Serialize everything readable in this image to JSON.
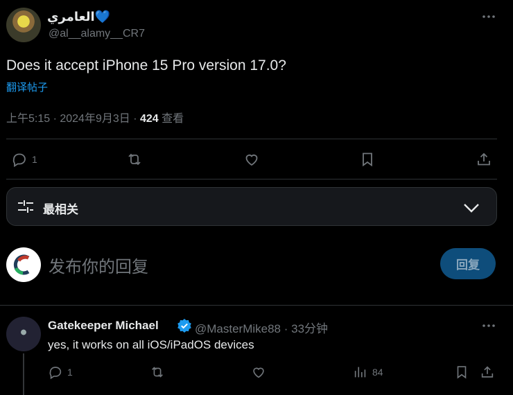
{
  "tweet": {
    "display_name": "العامري💙  ",
    "handle": "@al__alamy__CR7",
    "text": "Does it accept iPhone 15 Pro version 17.0?",
    "translate_label": "翻译帖子",
    "time": "上午5:15 · 2024年9月3日 · ",
    "views_count": "424",
    "views_label": " 查看",
    "replies_count": "1"
  },
  "sort": {
    "label": "最相关"
  },
  "composer": {
    "placeholder": "发布你的回复",
    "button_label": "回复"
  },
  "reply": {
    "display_name": "Gatekeeper Michael",
    "handle_time": "@MasterMike88 · 33分钟",
    "text": "yes, it works on all iOS/iPadOS devices",
    "replies_count": "1",
    "views_count": "84"
  },
  "colors": {
    "accent": "#1d9bf0",
    "muted": "#71767b",
    "background": "#000000"
  }
}
